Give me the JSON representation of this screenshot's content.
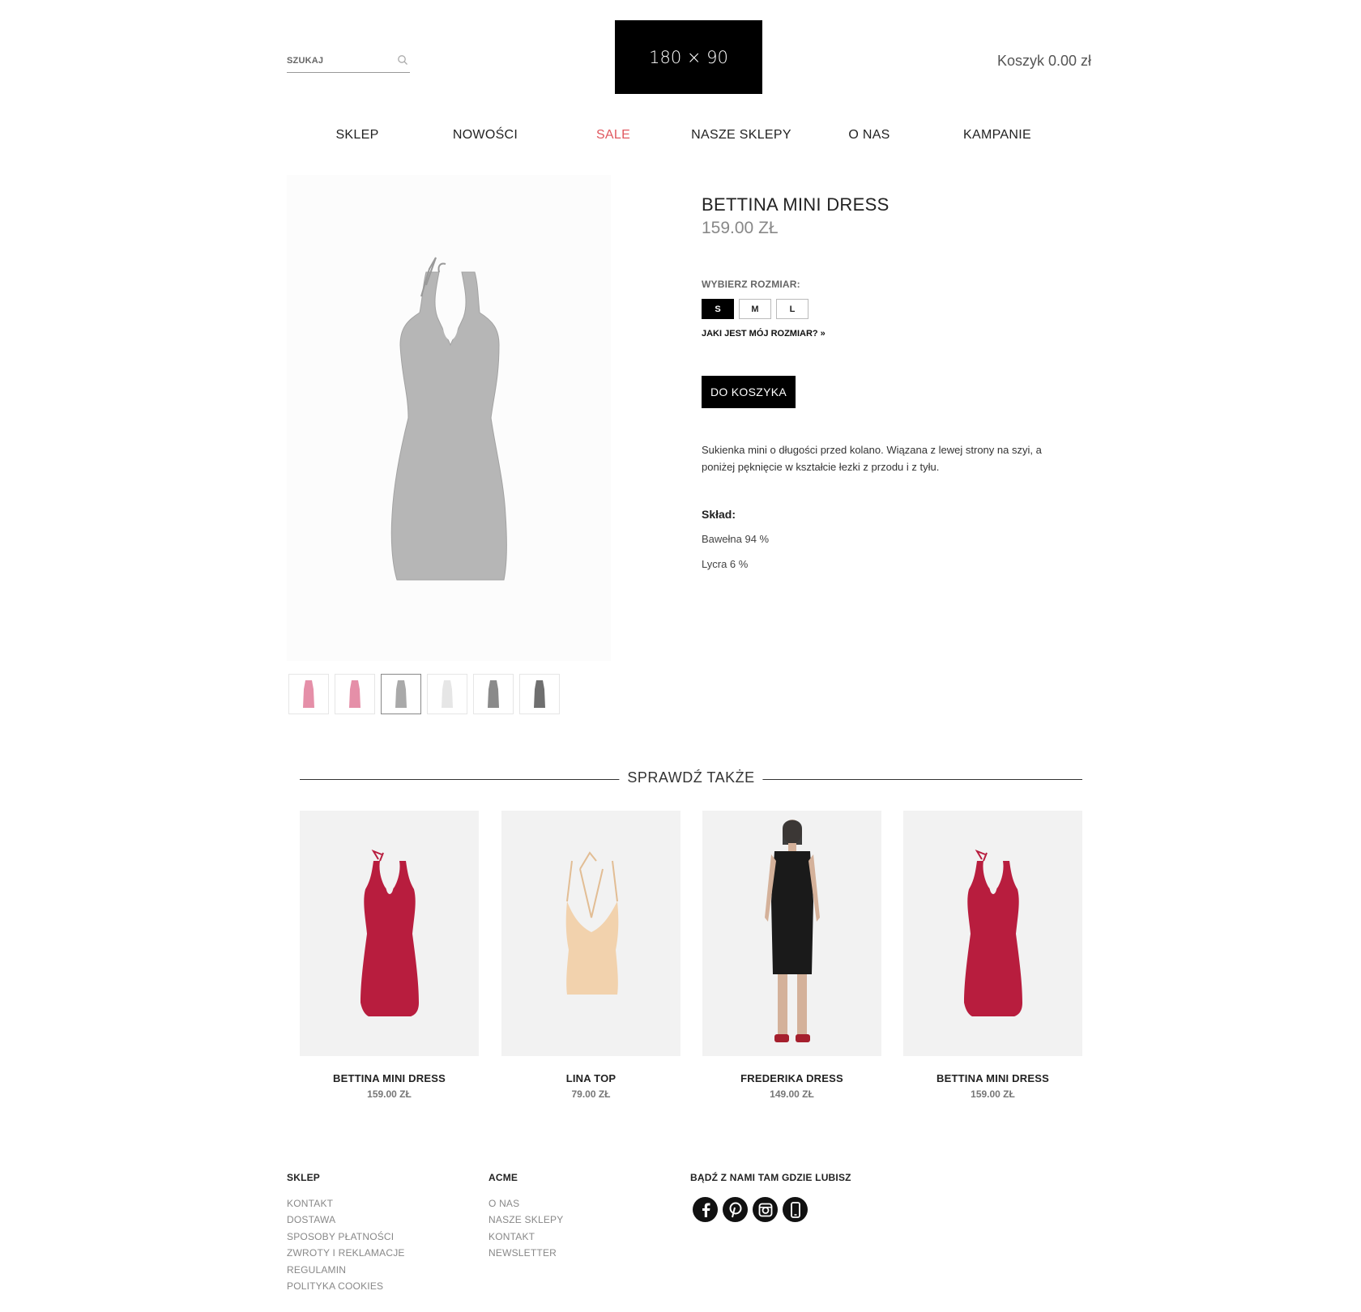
{
  "header": {
    "search_placeholder": "SZUKAJ",
    "logo_text": "180 × 90",
    "cart_label": "Koszyk 0.00 zł"
  },
  "nav": [
    {
      "label": "SKLEP"
    },
    {
      "label": "NOWOŚCI"
    },
    {
      "label": "SALE",
      "highlight": "#e0585f"
    },
    {
      "label": "NASZE SKLEPY"
    },
    {
      "label": "O NAS"
    },
    {
      "label": "KAMPANIE"
    }
  ],
  "product": {
    "title": "BETTINA MINI DRESS",
    "price": "159.00 ZŁ",
    "size_label": "WYBIERZ ROZMIAR:",
    "sizes": [
      "S",
      "M",
      "L"
    ],
    "selected_size": "S",
    "size_guide": "JAKI JEST MÓJ ROZMIAR? »",
    "add_to_cart": "DO KOSZYKA",
    "description": "Sukienka mini o długości przed kolano. Wiązana z lewej strony na szyi, a poniżej pęknięcie w kształcie łezki z przodu i z tyłu.",
    "composition_title": "Skład:",
    "composition": [
      "Bawełna 94 %",
      "Lycra 6 %"
    ],
    "thumbnails": [
      {
        "color": "#e58fa8"
      },
      {
        "color": "#e58fa8"
      },
      {
        "color": "#a9a9a9",
        "active": true
      },
      {
        "color": "#eeeeee"
      },
      {
        "color": "#8a8a8a"
      },
      {
        "color": "#6f6f6f"
      }
    ]
  },
  "related": {
    "title": "SPRAWDŹ TAKŻE",
    "items": [
      {
        "name": "BETTINA MINI DRESS",
        "price": "159.00 ZŁ"
      },
      {
        "name": "LINA TOP",
        "price": "79.00 ZŁ"
      },
      {
        "name": "FREDERIKA DRESS",
        "price": "149.00 ZŁ"
      },
      {
        "name": "BETTINA MINI DRESS",
        "price": "159.00 ZŁ"
      }
    ]
  },
  "footer": {
    "col1": {
      "title": "SKLEP",
      "links": [
        "KONTAKT",
        "DOSTAWA",
        "SPOSOBY PŁATNOŚCI",
        "ZWROTY I REKLAMACJE",
        "REGULAMIN",
        "POLITYKA COOKIES"
      ]
    },
    "col2": {
      "title": "ACME",
      "links": [
        "O NAS",
        "NASZE SKLEPY",
        "KONTAKT",
        "NEWSLETTER"
      ]
    },
    "col3": {
      "title": "BĄDŹ Z NAMI TAM GDZIE LUBISZ"
    },
    "social": [
      "facebook-icon",
      "pinterest-icon",
      "instagram-icon",
      "mobile-icon"
    ]
  },
  "colors": {
    "accent_sale": "#e0585f",
    "product_grey": "#b5b5b5",
    "dress_red": "#b81d3e",
    "top_nude": "#f2d2ad",
    "dress_black": "#1a1a1a"
  }
}
